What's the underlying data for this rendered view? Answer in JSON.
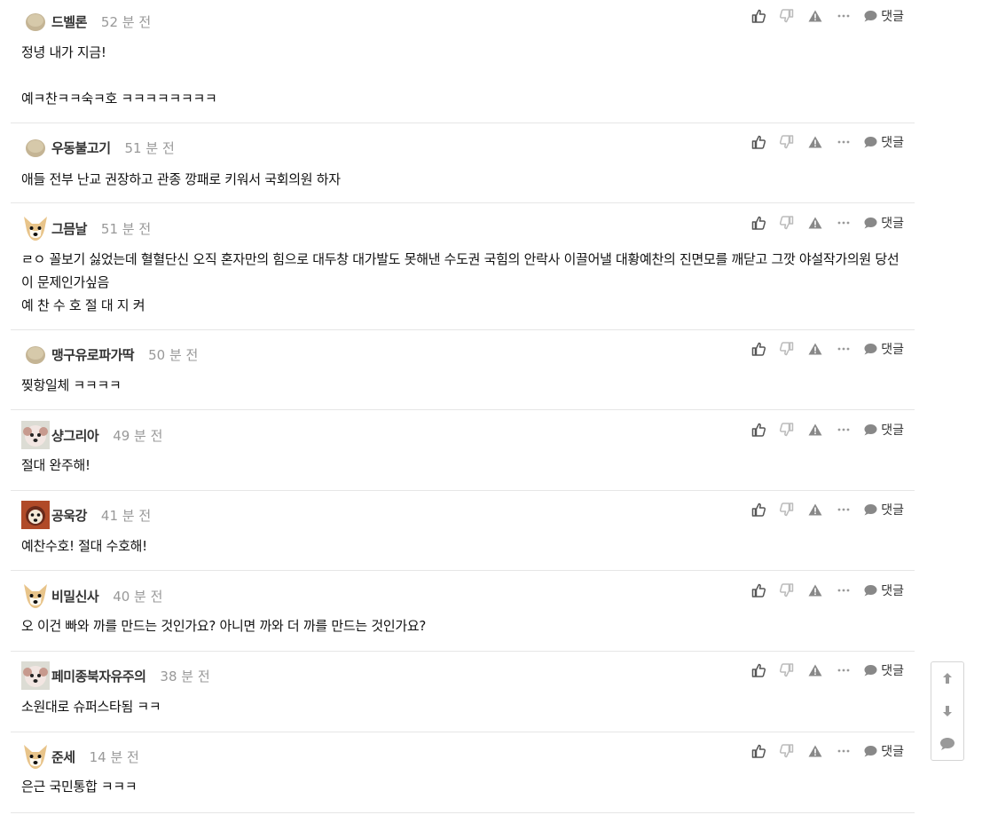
{
  "reply_label": "댓글",
  "comments": [
    {
      "nick": "드벨론",
      "time": "52 분 전",
      "avatar": "round",
      "lines": [
        "정녕 내가 지금!",
        "",
        "예ㅋ찬ㅋㅋ숙ㅋ호 ㅋㅋㅋㅋㅋㅋㅋㅋ"
      ]
    },
    {
      "nick": "우동불고기",
      "time": "51 분 전",
      "avatar": "round",
      "lines": [
        "애들 전부 난교 권장하고 관종 깡패로 키워서 국회의원 하자"
      ]
    },
    {
      "nick": "그믐날",
      "time": "51 분 전",
      "avatar": "dog",
      "lines": [
        "ㄹㅇ 꼴보기 싫었는데 혈혈단신 오직 혼자만의 힘으로 대두창 대가발도 못해낸 수도권 국힘의 안락사 이끌어낼 대황예찬의 진면모를 깨닫고 그깟 야설작가의원 당선이 문제인가싶음",
        "예 찬 수 호 절 대 지 켜"
      ]
    },
    {
      "nick": "맹구유로파가딱",
      "time": "50 분 전",
      "avatar": "round",
      "lines": [
        "찢항일체 ㅋㅋㅋㅋ"
      ]
    },
    {
      "nick": "샹그리아",
      "time": "49 분 전",
      "avatar": "pup",
      "lines": [
        "절대 완주해!"
      ]
    },
    {
      "nick": "공욱강",
      "time": "41 분 전",
      "avatar": "dark",
      "lines": [
        "예찬수호! 절대 수호해!"
      ]
    },
    {
      "nick": "비밀신사",
      "time": "40 분 전",
      "avatar": "dog",
      "lines": [
        "오 이건 빠와 까를 만드는 것인가요? 아니면 까와 더 까를 만드는 것인가요?"
      ]
    },
    {
      "nick": "페미종북자유주의",
      "time": "38 분 전",
      "avatar": "pup",
      "lines": [
        "소원대로 슈퍼스타됨 ㅋㅋ"
      ]
    },
    {
      "nick": "준세",
      "time": "14 분 전",
      "avatar": "dog",
      "lines": [
        "은근 국민통합 ㅋㅋㅋ"
      ]
    }
  ],
  "colors": {
    "icon": "#555555",
    "icon_light": "#b0b0b0",
    "divider": "#e6e6e6",
    "time": "#999999"
  }
}
